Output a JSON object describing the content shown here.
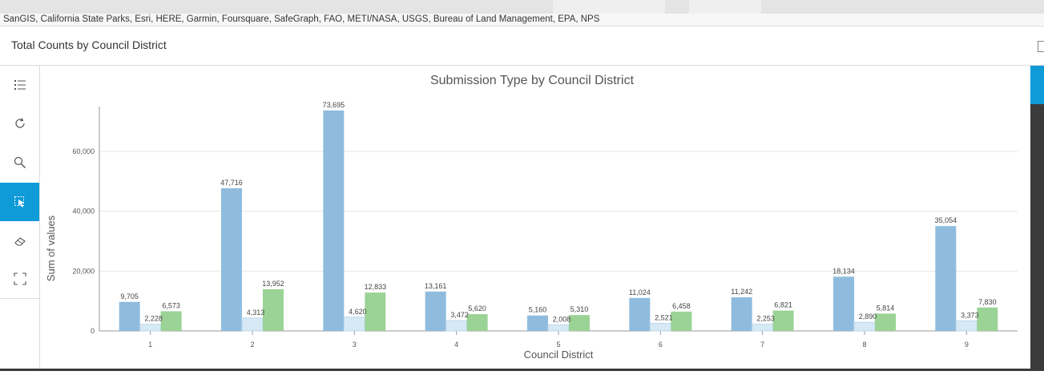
{
  "attribution": "SanGIS, California State Parks, Esri, HERE, Garmin, Foursquare, SafeGraph, FAO, METI/NASA, USGS, Bureau of Land Management, EPA, NPS",
  "panel": {
    "title": "Total Counts by Council District"
  },
  "toolbar": {
    "items": [
      {
        "name": "legend",
        "icon": "list-icon",
        "active": false
      },
      {
        "name": "refresh",
        "icon": "refresh-icon",
        "active": false
      },
      {
        "name": "zoom",
        "icon": "zoom-icon",
        "active": false
      },
      {
        "name": "selection",
        "icon": "selection-icon",
        "active": true
      },
      {
        "name": "clear",
        "icon": "eraser-icon",
        "active": false
      },
      {
        "name": "fullscreen",
        "icon": "expand-icon",
        "active": false
      }
    ]
  },
  "colors": {
    "series1": "#8fbcde",
    "series2": "#d6e9f5",
    "series3": "#9bd396",
    "accent": "#0f9ad8"
  },
  "chart_data": {
    "type": "bar",
    "title": "Submission Type by Council District",
    "xlabel": "Council District",
    "ylabel": "Sum of values",
    "categories": [
      "1",
      "2",
      "3",
      "4",
      "5",
      "6",
      "7",
      "8",
      "9"
    ],
    "ylim": [
      0,
      75000
    ],
    "yticks": [
      0,
      20000,
      40000,
      60000
    ],
    "ytick_labels": [
      "0",
      "20,000",
      "40,000",
      "60,000"
    ],
    "grid": true,
    "series": [
      {
        "values": [
          9705,
          47716,
          73695,
          13161,
          5160,
          11024,
          11242,
          18134,
          35054
        ],
        "labels": [
          "9,705",
          "47,716",
          "73,695",
          "13,161",
          "5,160",
          "11,024",
          "11,242",
          "18,134",
          "35,054"
        ]
      },
      {
        "values": [
          2228,
          4313,
          4620,
          3472,
          2008,
          2521,
          2253,
          2890,
          3373
        ],
        "labels": [
          "2,228",
          "4,313",
          "4,620",
          "3,472",
          "2,008",
          "2,521",
          "2,253",
          "2,890",
          "3,373"
        ]
      },
      {
        "values": [
          6573,
          13952,
          12833,
          5620,
          5310,
          6458,
          6821,
          5814,
          7830
        ],
        "labels": [
          "6,573",
          "13,952",
          "12,833",
          "5,620",
          "5,310",
          "6,458",
          "6,821",
          "5,814",
          "7,830"
        ]
      }
    ]
  }
}
